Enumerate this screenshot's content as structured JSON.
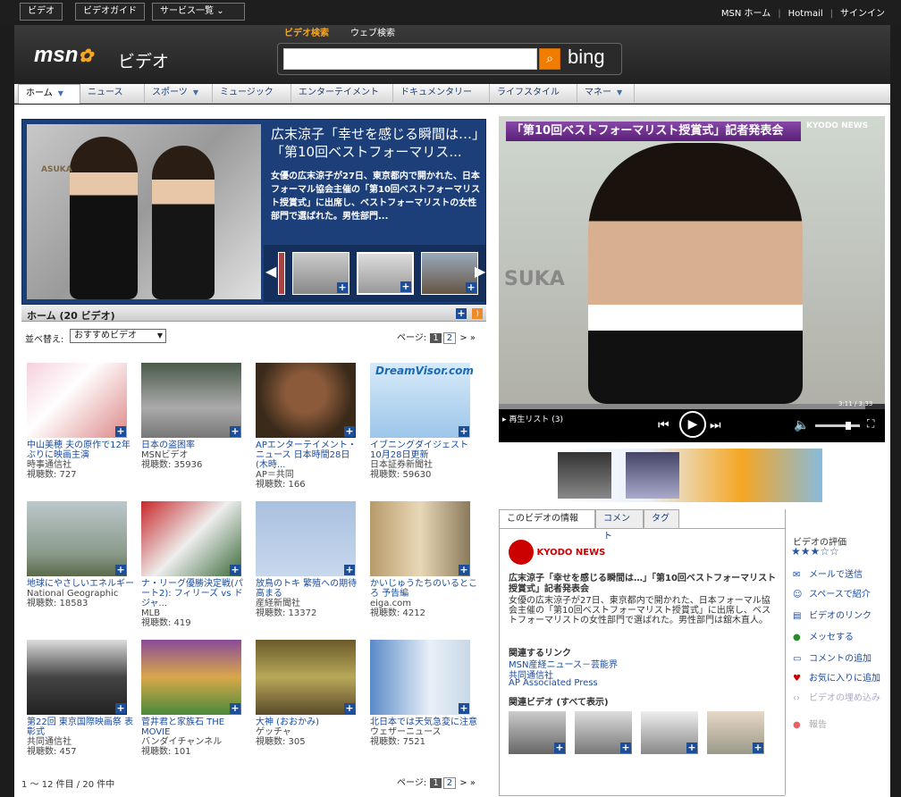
{
  "topbar": {
    "btn_video": "ビデオ",
    "btn_guide": "ビデオガイド",
    "btn_services": "サービス一覧",
    "link_home": "MSN ホーム",
    "link_hotmail": "Hotmail",
    "link_signin": "サインイン"
  },
  "header": {
    "logo": "msn",
    "logo_sub": "ビデオ",
    "tab_video_search": "ビデオ検索",
    "tab_web_search": "ウェブ検索",
    "search_placeholder": "",
    "bing": "bing"
  },
  "nav": [
    "ホーム",
    "ニュース",
    "スポーツ",
    "ミュージック",
    "エンターテイメント",
    "ドキュメンタリー",
    "ライフスタイル",
    "マネー"
  ],
  "feature": {
    "title": "広末涼子「幸せを感じる瞬間は…」「第10回ベストフォーマリス...",
    "desc": "女優の広末涼子が27日、東京都内で開かれた、日本フォーマル協会主催の「第10回ベストフォーマリスト授賞式」に出席し、ベストフォーマリストの女性部門で選ばれた。男性部門..."
  },
  "section": {
    "title": "ホーム (20 ビデオ)",
    "sort_label": "並べ替え:",
    "sort_value": "おすすめビデオ",
    "page_label": "ページ:",
    "page_current": "1",
    "page_next": "2",
    "range": "1 ～ 12 件目 / 20 件中"
  },
  "tiles": [
    {
      "title": "中山美穂 夫の原作で12年ぶりに映画主演",
      "src": "時事通信社",
      "views": "視聴数: 727"
    },
    {
      "title": "日本の盗困率",
      "src": "MSNビデオ",
      "views": "視聴数: 35936"
    },
    {
      "title": "APエンターテイメント・ニュース 日本時間28日 (木時...",
      "src": "AP＝共同",
      "views": "視聴数: 166"
    },
    {
      "title": "イブニングダイジェスト 10月28日更新",
      "src": "日本証券新聞社",
      "views": "視聴数: 59630"
    },
    {
      "title": "地球にやさしいエネルギー",
      "src": "National Geographic",
      "views": "視聴数: 18583"
    },
    {
      "title": "ナ・リーグ優勝決定戦(パート2): フィリーズ vs ドジャ...",
      "src": "MLB",
      "views": "視聴数: 419"
    },
    {
      "title": "放鳥のトキ 繁殖への期待高まる",
      "src": "産経新聞社",
      "views": "視聴数: 13372"
    },
    {
      "title": "かいじゅうたちのいるところ 予告編",
      "src": "eiga.com",
      "views": "視聴数: 4212"
    },
    {
      "title": "第22回 東京国際映画祭 表彰式",
      "src": "共同通信社",
      "views": "視聴数: 457"
    },
    {
      "title": "菅井君と家族石 THE MOVIE",
      "src": "バンダイチャンネル",
      "views": "視聴数: 101"
    },
    {
      "title": "大神 (おおかみ)",
      "src": "ゲッチャ",
      "views": "視聴数: 305"
    },
    {
      "title": "北日本では天気急変に注意",
      "src": "ウェザーニュース",
      "views": "視聴数: 7521"
    }
  ],
  "player": {
    "banner": "「第10回ベストフォーマリスト授賞式」記者発表会",
    "kyodo": "KYODO NEWS",
    "timecode": "3:11 / 3:33",
    "playlist": "再生リスト (3)",
    "progress": 0.95
  },
  "info": {
    "tab_info": "このビデオの情報",
    "tab_comment": "コメント",
    "tab_tag": "タグ",
    "logo": "KYODO NEWS",
    "title": "広末涼子「幸せを感じる瞬間は…」「第10回ベストフォーマリスト授賞式」記者発表会",
    "desc": "女優の広末涼子が27日、東京都内で開かれた、日本フォーマル協会主催の「第10回ベストフォーマリスト授賞式」に出席し、ベストフォーマリストの女性部門で選ばれた。男性部門は舘木直人。",
    "links_h": "関連するリンク",
    "links": [
      "MSN産経ニュース－芸能界",
      "共同通信社",
      "AP Associated Press"
    ],
    "related_h": "関連ビデオ (すべて表示)"
  },
  "side": {
    "rating_label": "ビデオの評価",
    "rating": 2.5,
    "actions": [
      "メールで送信",
      "スペースで紹介",
      "ビデオのリンク",
      "メッセする",
      "コメントの追加",
      "お気に入りに追加",
      "ビデオの埋め込み",
      "報告"
    ]
  }
}
